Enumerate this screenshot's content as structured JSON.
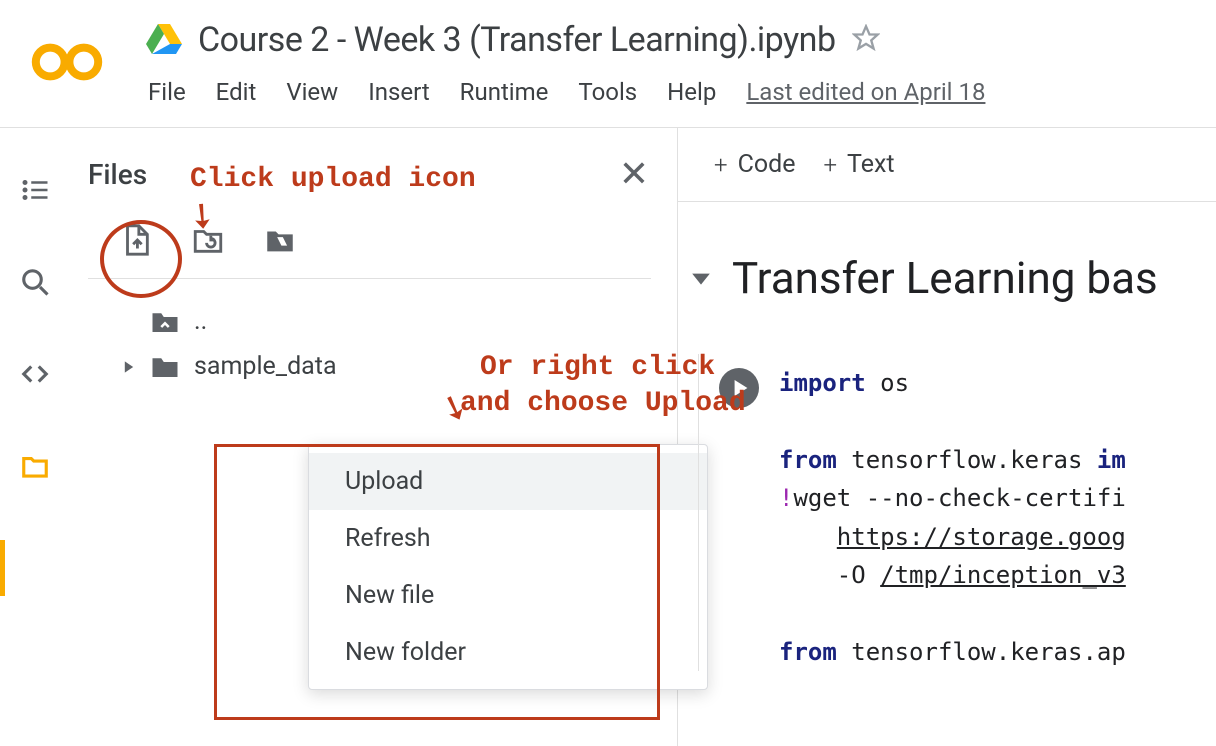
{
  "header": {
    "title": "Course 2 - Week 3 (Transfer Learning).ipynb",
    "menus": [
      "File",
      "Edit",
      "View",
      "Insert",
      "Runtime",
      "Tools",
      "Help"
    ],
    "last_edited": "Last edited on April 18"
  },
  "sidebar": {
    "title": "Files",
    "tree": {
      "up_label": "..",
      "folder_label": "sample_data"
    },
    "context_menu": [
      "Upload",
      "Refresh",
      "New file",
      "New folder"
    ]
  },
  "notebook": {
    "toolbar_code": "Code",
    "toolbar_text": "Text",
    "heading": "Transfer Learning bas",
    "code_lines": [
      {
        "parts": [
          {
            "t": "import ",
            "c": "kw"
          },
          {
            "t": "os"
          }
        ]
      },
      {
        "parts": []
      },
      {
        "parts": [
          {
            "t": "from ",
            "c": "kw"
          },
          {
            "t": "tensorflow.keras "
          },
          {
            "t": "im",
            "c": "kw"
          }
        ]
      },
      {
        "parts": [
          {
            "t": "!",
            "c": "op"
          },
          {
            "t": "wget --no-check-certifi"
          }
        ]
      },
      {
        "parts": [
          {
            "t": "    "
          },
          {
            "t": "https://storage.goog",
            "c": "lnk"
          }
        ]
      },
      {
        "parts": [
          {
            "t": "    -O "
          },
          {
            "t": "/tmp/inception_v3",
            "c": "lnk"
          }
        ]
      },
      {
        "parts": []
      },
      {
        "parts": [
          {
            "t": "from ",
            "c": "kw"
          },
          {
            "t": "tensorflow.keras.ap"
          }
        ]
      }
    ]
  },
  "annotations": {
    "upload_hint": "Click upload icon",
    "ctx_hint_l1": "Or right click",
    "ctx_hint_l2": "and choose Upload"
  }
}
